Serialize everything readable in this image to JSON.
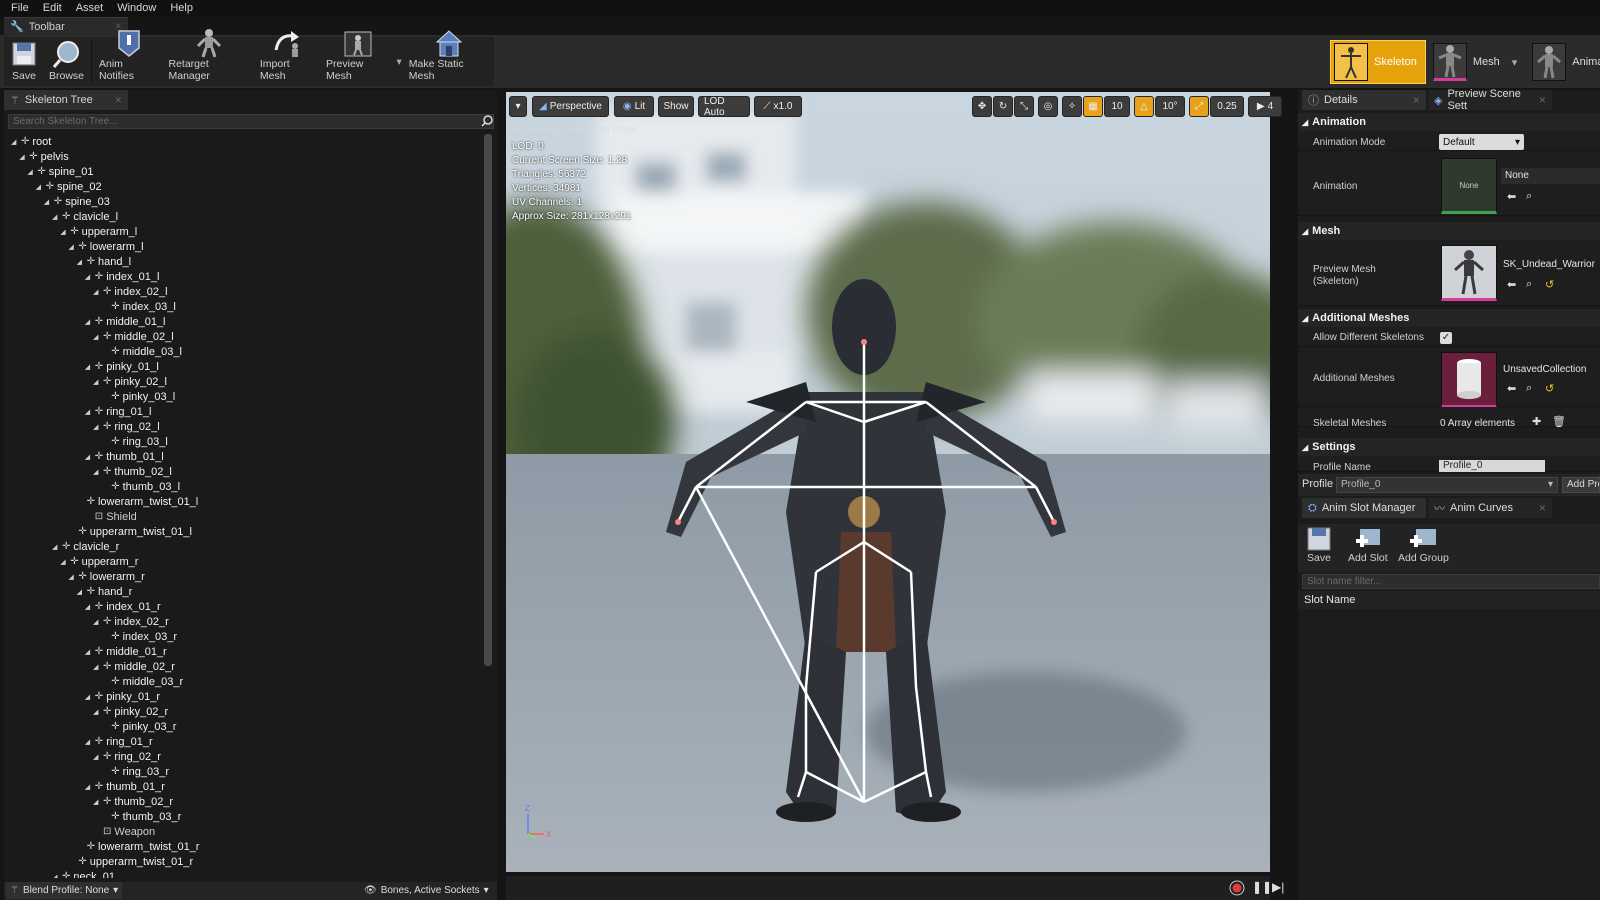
{
  "menu": [
    "File",
    "Edit",
    "Asset",
    "Window",
    "Help"
  ],
  "toolbar_tab": "Toolbar",
  "toolbar": [
    {
      "label": "Save",
      "icon": "save-icon"
    },
    {
      "label": "Browse",
      "icon": "browse-icon"
    },
    {
      "label": "Anim Notifies",
      "icon": "anim-notifies-icon"
    },
    {
      "label": "Retarget Manager",
      "icon": "retarget-icon"
    },
    {
      "label": "Import Mesh",
      "icon": "import-mesh-icon"
    },
    {
      "label": "Preview Mesh",
      "icon": "preview-mesh-icon"
    },
    {
      "label": "Make Static Mesh",
      "icon": "make-static-mesh-icon"
    }
  ],
  "modes": {
    "skeleton": "Skeleton",
    "mesh": "Mesh",
    "animation": "Animation"
  },
  "skeleton_tree": {
    "tab": "Skeleton Tree",
    "search_placeholder": "Search Skeleton Tree...",
    "nodes": [
      {
        "label": "root",
        "depth": 0,
        "arrow": true
      },
      {
        "label": "pelvis",
        "depth": 1,
        "arrow": true
      },
      {
        "label": "spine_01",
        "depth": 2,
        "arrow": true
      },
      {
        "label": "spine_02",
        "depth": 3,
        "arrow": true
      },
      {
        "label": "spine_03",
        "depth": 4,
        "arrow": true
      },
      {
        "label": "clavicle_l",
        "depth": 5,
        "arrow": true
      },
      {
        "label": "upperarm_l",
        "depth": 6,
        "arrow": true
      },
      {
        "label": "lowerarm_l",
        "depth": 7,
        "arrow": true
      },
      {
        "label": "hand_l",
        "depth": 8,
        "arrow": true
      },
      {
        "label": "index_01_l",
        "depth": 9,
        "arrow": true
      },
      {
        "label": "index_02_l",
        "depth": 10,
        "arrow": true
      },
      {
        "label": "index_03_l",
        "depth": 11,
        "arrow": false
      },
      {
        "label": "middle_01_l",
        "depth": 9,
        "arrow": true
      },
      {
        "label": "middle_02_l",
        "depth": 10,
        "arrow": true
      },
      {
        "label": "middle_03_l",
        "depth": 11,
        "arrow": false
      },
      {
        "label": "pinky_01_l",
        "depth": 9,
        "arrow": true
      },
      {
        "label": "pinky_02_l",
        "depth": 10,
        "arrow": true
      },
      {
        "label": "pinky_03_l",
        "depth": 11,
        "arrow": false
      },
      {
        "label": "ring_01_l",
        "depth": 9,
        "arrow": true
      },
      {
        "label": "ring_02_l",
        "depth": 10,
        "arrow": true
      },
      {
        "label": "ring_03_l",
        "depth": 11,
        "arrow": false
      },
      {
        "label": "thumb_01_l",
        "depth": 9,
        "arrow": true
      },
      {
        "label": "thumb_02_l",
        "depth": 10,
        "arrow": true
      },
      {
        "label": "thumb_03_l",
        "depth": 11,
        "arrow": false
      },
      {
        "label": "lowerarm_twist_01_l",
        "depth": 8,
        "arrow": false
      },
      {
        "label": "Shield",
        "depth": 9,
        "arrow": false,
        "socket": true
      },
      {
        "label": "upperarm_twist_01_l",
        "depth": 7,
        "arrow": false
      },
      {
        "label": "clavicle_r",
        "depth": 5,
        "arrow": true
      },
      {
        "label": "upperarm_r",
        "depth": 6,
        "arrow": true
      },
      {
        "label": "lowerarm_r",
        "depth": 7,
        "arrow": true
      },
      {
        "label": "hand_r",
        "depth": 8,
        "arrow": true
      },
      {
        "label": "index_01_r",
        "depth": 9,
        "arrow": true
      },
      {
        "label": "index_02_r",
        "depth": 10,
        "arrow": true
      },
      {
        "label": "index_03_r",
        "depth": 11,
        "arrow": false
      },
      {
        "label": "middle_01_r",
        "depth": 9,
        "arrow": true
      },
      {
        "label": "middle_02_r",
        "depth": 10,
        "arrow": true
      },
      {
        "label": "middle_03_r",
        "depth": 11,
        "arrow": false
      },
      {
        "label": "pinky_01_r",
        "depth": 9,
        "arrow": true
      },
      {
        "label": "pinky_02_r",
        "depth": 10,
        "arrow": true
      },
      {
        "label": "pinky_03_r",
        "depth": 11,
        "arrow": false
      },
      {
        "label": "ring_01_r",
        "depth": 9,
        "arrow": true
      },
      {
        "label": "ring_02_r",
        "depth": 10,
        "arrow": true
      },
      {
        "label": "ring_03_r",
        "depth": 11,
        "arrow": false
      },
      {
        "label": "thumb_01_r",
        "depth": 9,
        "arrow": true
      },
      {
        "label": "thumb_02_r",
        "depth": 10,
        "arrow": true
      },
      {
        "label": "thumb_03_r",
        "depth": 11,
        "arrow": false
      },
      {
        "label": "Weapon",
        "depth": 10,
        "arrow": false,
        "socket": true
      },
      {
        "label": "lowerarm_twist_01_r",
        "depth": 8,
        "arrow": false
      },
      {
        "label": "upperarm_twist_01_r",
        "depth": 7,
        "arrow": false
      },
      {
        "label": "neck_01",
        "depth": 5,
        "arrow": true
      }
    ],
    "footer_blend": "Blend Profile: None",
    "footer_bones": "Bones, Active Sockets"
  },
  "viewport": {
    "buttons": {
      "perspective": "Perspective",
      "lit": "Lit",
      "show": "Show",
      "lod": "LOD Auto",
      "speed": "x1.0"
    },
    "snap": {
      "grid": "10",
      "rot": "10°",
      "scale": "0.25",
      "cam": "4"
    },
    "previewing": "Previewing Reference Pose",
    "info": [
      "LOD: 0",
      "Current Screen Size: 1.28",
      "Triangles: 56372",
      "Vertices: 34981",
      "UV Channels: 1",
      "Approx Size: 281x128x291"
    ]
  },
  "details": {
    "tab": "Details",
    "tab2": "Preview Scene Sett",
    "animation_cat": "Animation",
    "animation_mode_label": "Animation Mode",
    "animation_mode_value": "Default",
    "animation_label": "Animation",
    "animation_thumb": "None",
    "animation_value": "None",
    "mesh_cat": "Mesh",
    "preview_mesh_label": "Preview Mesh (Skeleton)",
    "preview_mesh_value": "SK_Undead_Warrior",
    "additional_cat": "Additional Meshes",
    "allow_label": "Allow Different Skeletons",
    "allow_checked": true,
    "additional_label": "Additional Meshes",
    "additional_value": "UnsavedCollection",
    "skeletal_label": "Skeletal Meshes",
    "skeletal_value": "0 Array elements",
    "settings_cat": "Settings",
    "profile_name_label": "Profile Name",
    "profile_name_value": "Profile_0",
    "profile_label": "Profile",
    "profile_value": "Profile_0",
    "add_profile": "Add Pro"
  },
  "slots": {
    "tab": "Anim Slot Manager",
    "tab2": "Anim Curves",
    "save": "Save",
    "add_slot": "Add Slot",
    "add_group": "Add Group",
    "filter_placeholder": "Slot name filter...",
    "header": "Slot Name"
  },
  "colors": {
    "accent": "#e5a20a",
    "panel": "#1c1c1c",
    "selection_pink": "#d53c9a"
  }
}
